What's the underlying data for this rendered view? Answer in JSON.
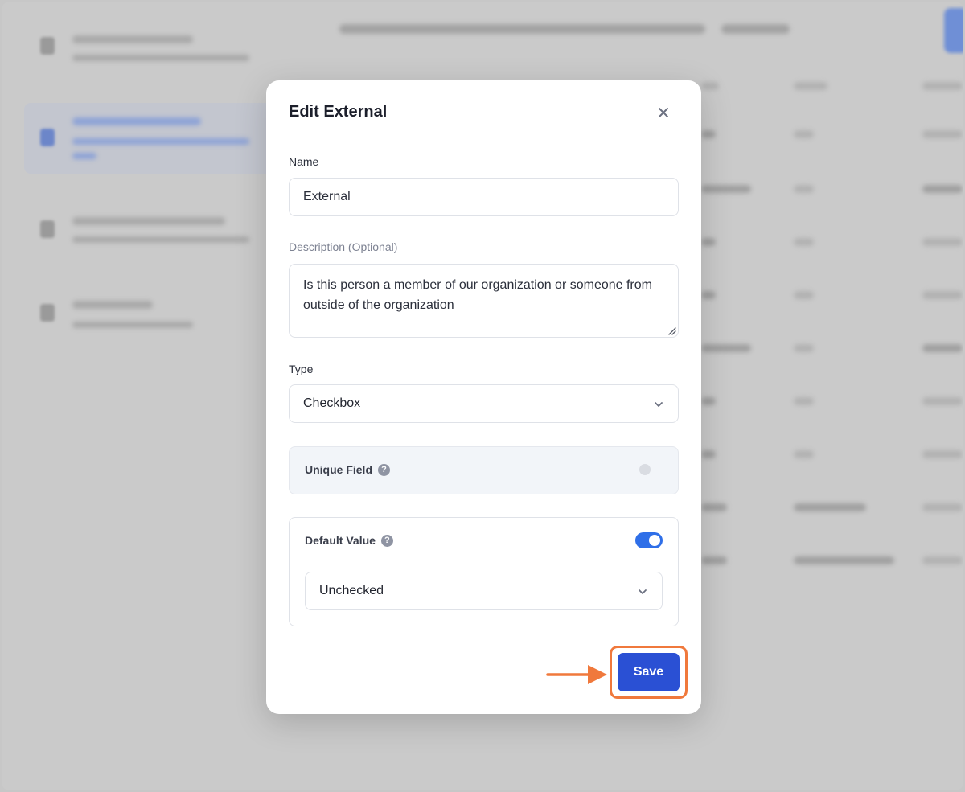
{
  "modal": {
    "title": "Edit External",
    "name_label": "Name",
    "name_value": "External",
    "description_label": "Description (Optional)",
    "description_value": "Is this person a member of our organization or someone from outside of the organization",
    "type_label": "Type",
    "type_value": "Checkbox",
    "unique_field_label": "Unique Field",
    "unique_field_enabled": false,
    "default_value_label": "Default Value",
    "default_value_enabled": true,
    "default_value_selected": "Unchecked",
    "save_label": "Save"
  },
  "help_icon_glyph": "?",
  "colors": {
    "primary_button": "#2a50d4",
    "toggle_on": "#2f6fe8",
    "highlight": "#f0793c"
  },
  "icons": [
    "close-icon",
    "chevron-down-icon",
    "help-icon",
    "arrow-right-icon",
    "resize-grip-icon"
  ]
}
